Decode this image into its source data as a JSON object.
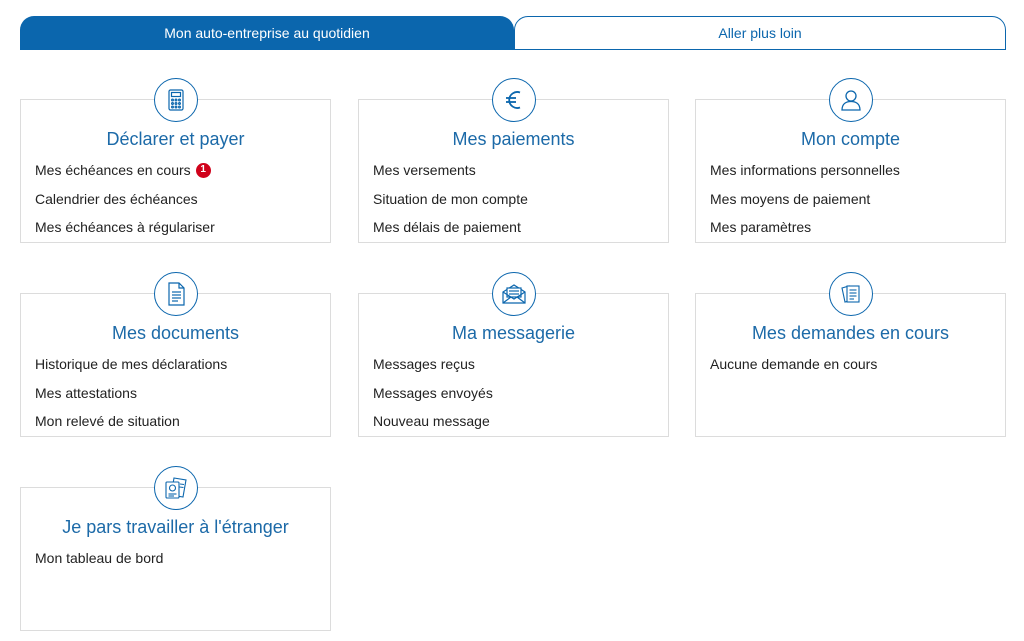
{
  "tabs": [
    {
      "label": "Mon auto-entreprise au quotidien",
      "active": true
    },
    {
      "label": "Aller plus loin",
      "active": false
    }
  ],
  "colors": {
    "accent": "#0b66ad",
    "title": "#1c6aa8",
    "badge": "#d0021b",
    "border": "#dcdcdc"
  },
  "cards": [
    {
      "title": "Déclarer et payer",
      "icon": "calculator-icon",
      "links": [
        "Mes échéances en cours",
        "Calendrier des échéances",
        "Mes échéances à régulariser"
      ],
      "badge": "1"
    },
    {
      "title": "Mes paiements",
      "icon": "euro-icon",
      "links": [
        "Mes versements",
        "Situation de mon compte",
        "Mes délais de paiement"
      ]
    },
    {
      "title": "Mon compte",
      "icon": "user-icon",
      "links": [
        "Mes informations personnelles",
        "Mes moyens de paiement",
        "Mes paramètres"
      ]
    },
    {
      "title": "Mes documents",
      "icon": "document-icon",
      "links": [
        "Historique de mes déclarations",
        "Mes attestations",
        "Mon relevé de situation"
      ]
    },
    {
      "title": "Ma messagerie",
      "icon": "envelope-icon",
      "links": [
        "Messages reçus",
        "Messages envoyés",
        "Nouveau message"
      ]
    },
    {
      "title": "Mes demandes en cours",
      "icon": "requests-icon",
      "links": [
        "Aucune demande en cours"
      ]
    },
    {
      "title": "Je pars travailler à l'étranger",
      "icon": "passport-icon",
      "links": [
        "Mon tableau de bord"
      ]
    }
  ]
}
